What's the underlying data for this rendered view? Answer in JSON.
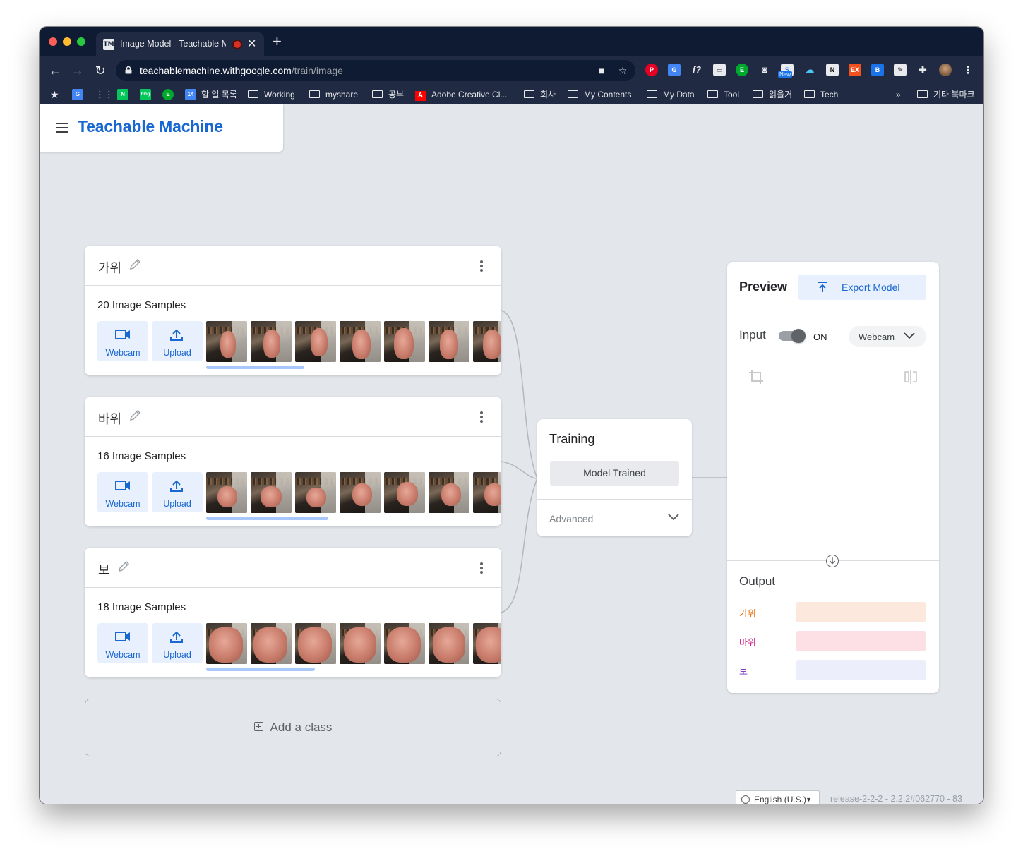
{
  "browser": {
    "tab_title": "Image Model - Teachable Machine",
    "tab_favicon": "TM",
    "url_host": "teachablemachine.withgoogle.com",
    "url_path": "/train/image",
    "bookmarks": [
      {
        "label": "할 일 목록",
        "type": "app"
      },
      {
        "label": "Working",
        "type": "folder"
      },
      {
        "label": "myshare",
        "type": "folder"
      },
      {
        "label": "공부",
        "type": "folder"
      },
      {
        "label": "Adobe Creative Cl...",
        "type": "app"
      },
      {
        "label": "회사",
        "type": "folder"
      },
      {
        "label": "My Contents",
        "type": "folder"
      },
      {
        "label": "My Data",
        "type": "folder"
      },
      {
        "label": "Tool",
        "type": "folder"
      },
      {
        "label": "읽을거",
        "type": "folder"
      },
      {
        "label": "Tech",
        "type": "folder"
      }
    ],
    "bookmarks_overflow": "»",
    "other_bookmarks": "기타 북마크",
    "calendar_day": "14",
    "new_badge": "New"
  },
  "app": {
    "brand": "Teachable Machine"
  },
  "classes": [
    {
      "name": "가위",
      "samples": "20 Image Samples",
      "webcam": "Webcam",
      "upload": "Upload"
    },
    {
      "name": "바위",
      "samples": "16 Image Samples",
      "webcam": "Webcam",
      "upload": "Upload"
    },
    {
      "name": "보",
      "samples": "18 Image Samples",
      "webcam": "Webcam",
      "upload": "Upload"
    }
  ],
  "add_class": "Add a class",
  "training": {
    "title": "Training",
    "button": "Model Trained",
    "advanced": "Advanced"
  },
  "preview": {
    "title": "Preview",
    "export": "Export Model",
    "input_label": "Input",
    "toggle_state": "ON",
    "source": "Webcam",
    "output_label": "Output",
    "outputs": [
      {
        "label": "가위",
        "color": "#e8710a",
        "bar": "#fce8dc"
      },
      {
        "label": "바위",
        "color": "#d01884",
        "bar": "#fde0e6"
      },
      {
        "label": "보",
        "color": "#7627bb",
        "bar": "#eceefb"
      }
    ]
  },
  "footer": {
    "language": "English (U.S.)",
    "release": "release-2-2-2 - 2.2.2#062770 - 83"
  },
  "colors": {
    "brand": "#1967d2",
    "chrome_dark": "#0f1b33",
    "page_bg": "#e3e6ea"
  }
}
